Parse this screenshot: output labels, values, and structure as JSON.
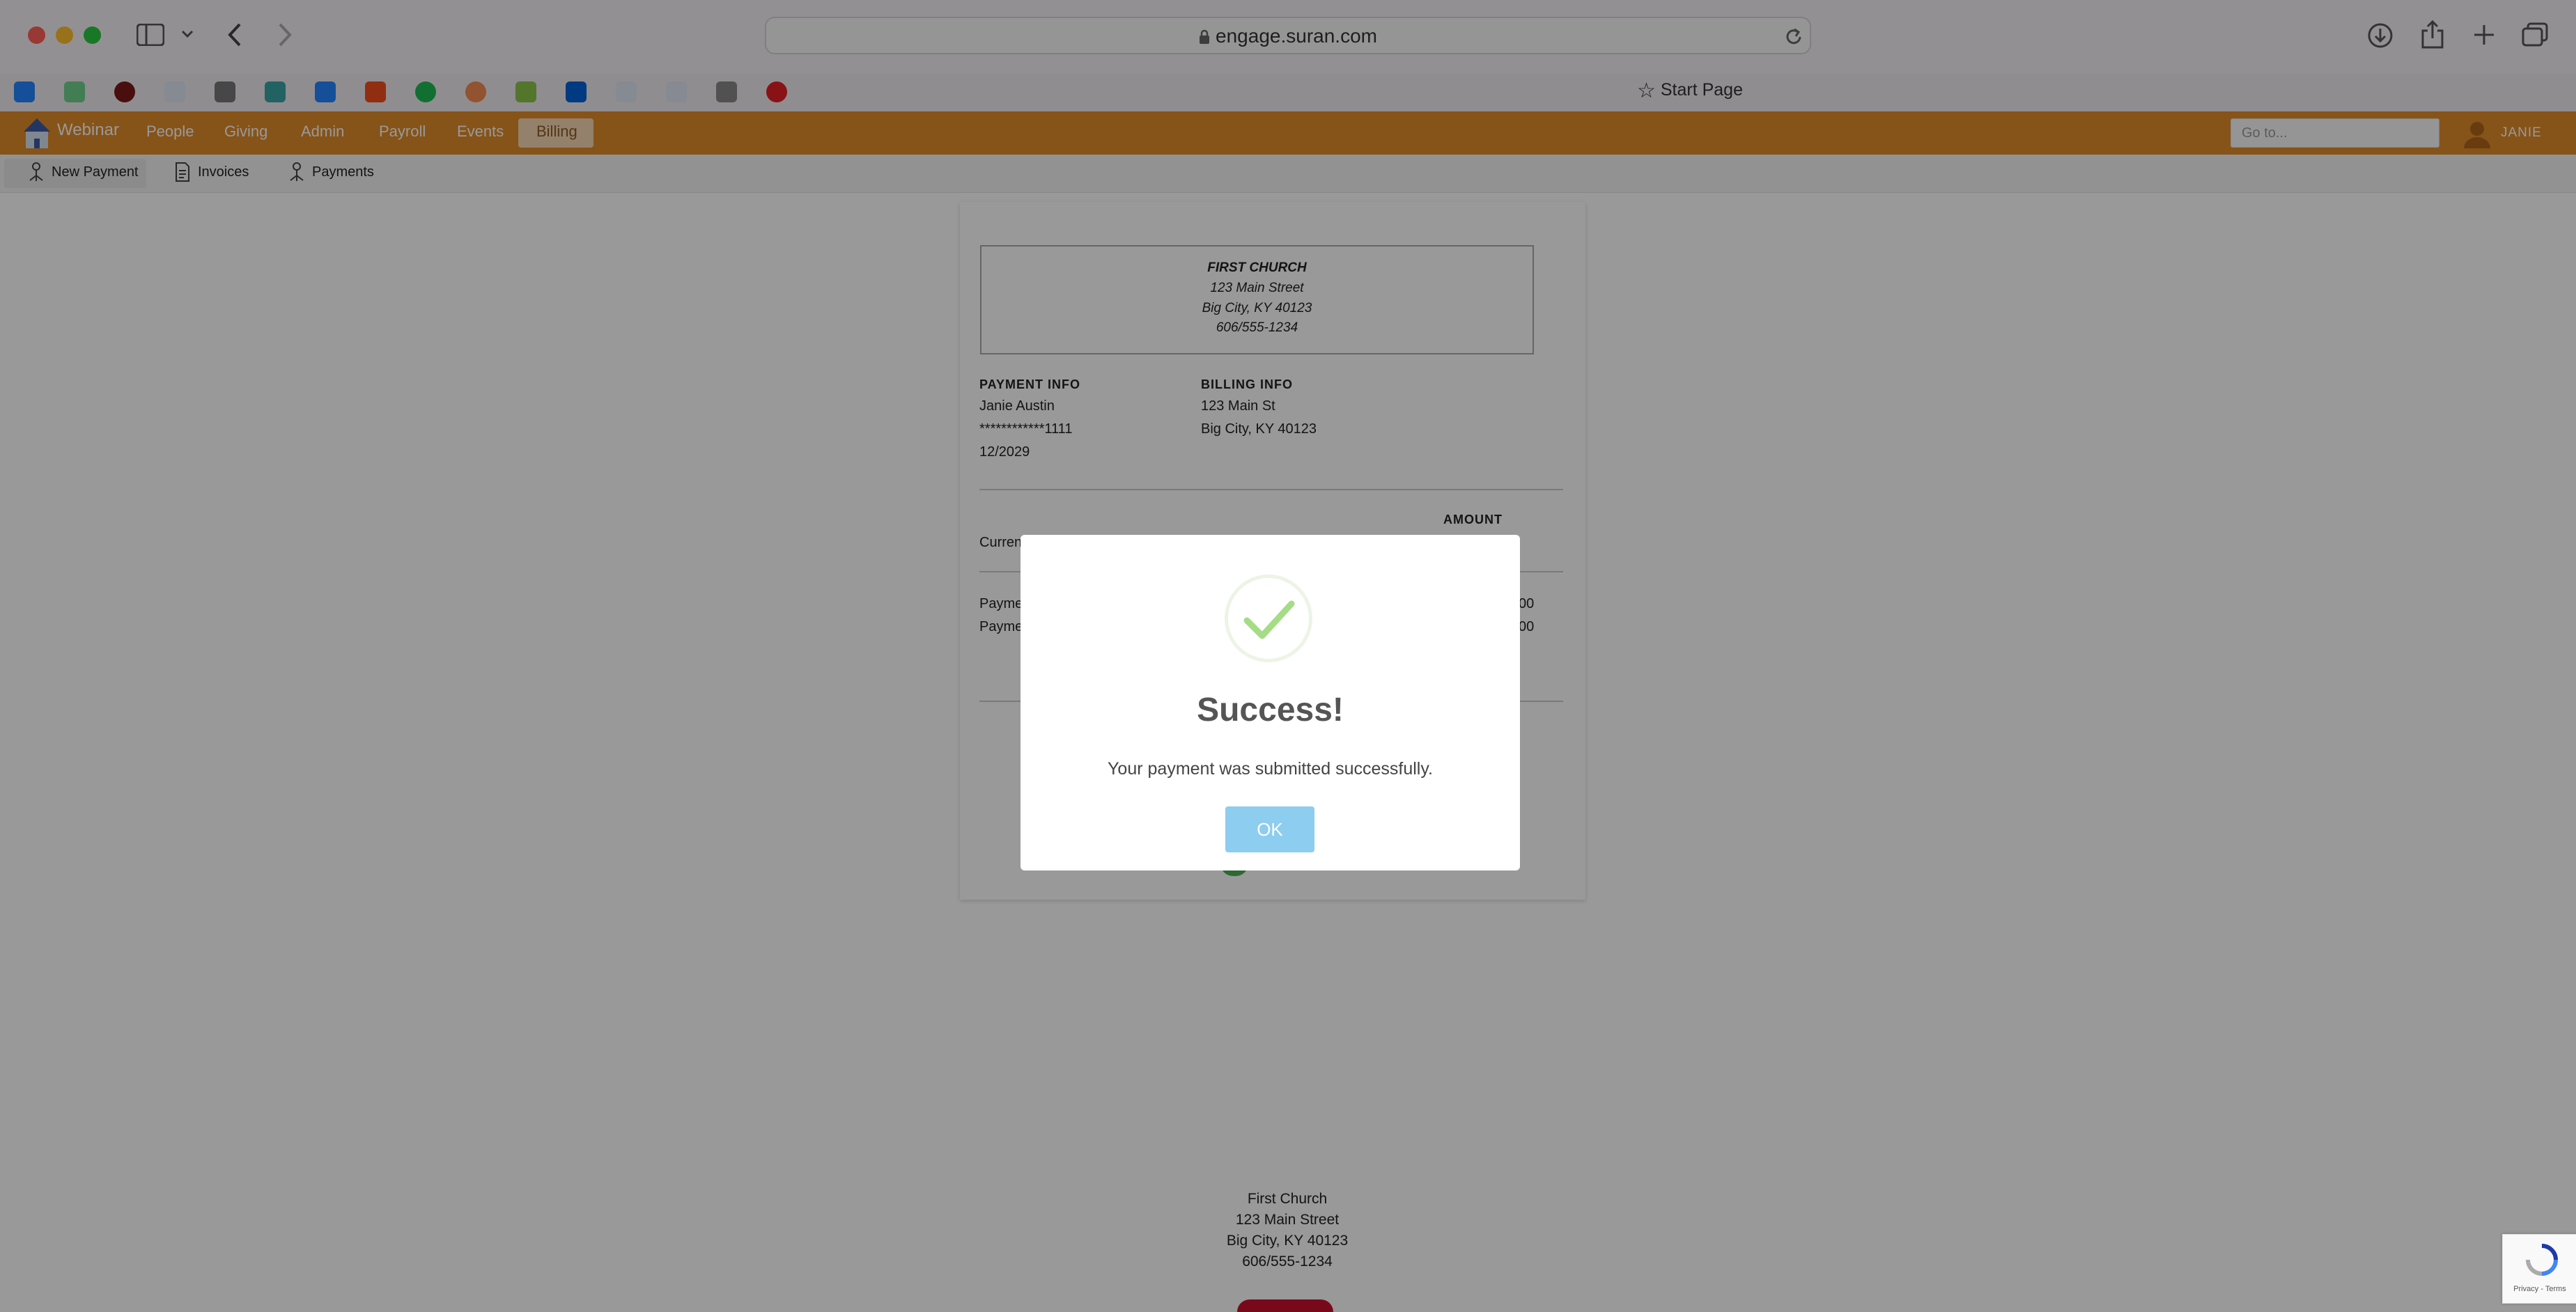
{
  "browser": {
    "url": "engage.suran.com",
    "start_page_label": "Start Page"
  },
  "nav": {
    "brand": "Webinar",
    "items": [
      "People",
      "Giving",
      "Admin",
      "Payroll",
      "Events",
      "Billing"
    ],
    "active": "Billing",
    "goto_placeholder": "Go to...",
    "user": "JANIE"
  },
  "subnav": {
    "items": [
      "New Payment",
      "Invoices",
      "Payments"
    ],
    "active": "New Payment"
  },
  "receipt": {
    "org_name": "FIRST CHURCH",
    "org_street": "123 Main Street",
    "org_city": "Big City, KY 40123",
    "org_phone": "606/555-1234",
    "payment_info_label": "PAYMENT INFO",
    "payer_name": "Janie Austin",
    "card_number": "************1111",
    "card_exp": "12/2029",
    "billing_info_label": "BILLING INFO",
    "billing_street": "123 Main St",
    "billing_city": "Big City, KY 40123",
    "amount_label": "AMOUNT",
    "row_current": "Curren",
    "row_payment_1": "Payme",
    "row_payment_2": "Payme",
    "amount_1_tail": "00",
    "amount_2_tail": "00"
  },
  "footer": {
    "name": "First Church",
    "street": "123 Main Street",
    "city": "Big City, KY 40123",
    "phone": "606/555-1234"
  },
  "modal": {
    "title": "Success!",
    "message": "Your payment was submitted successfully.",
    "ok_label": "OK"
  },
  "recaptcha": {
    "links": "Privacy - Terms"
  },
  "colors": {
    "brand_orange": "#e08a28",
    "ok_button": "#8dcdf0",
    "success_check": "#a5dc86"
  }
}
